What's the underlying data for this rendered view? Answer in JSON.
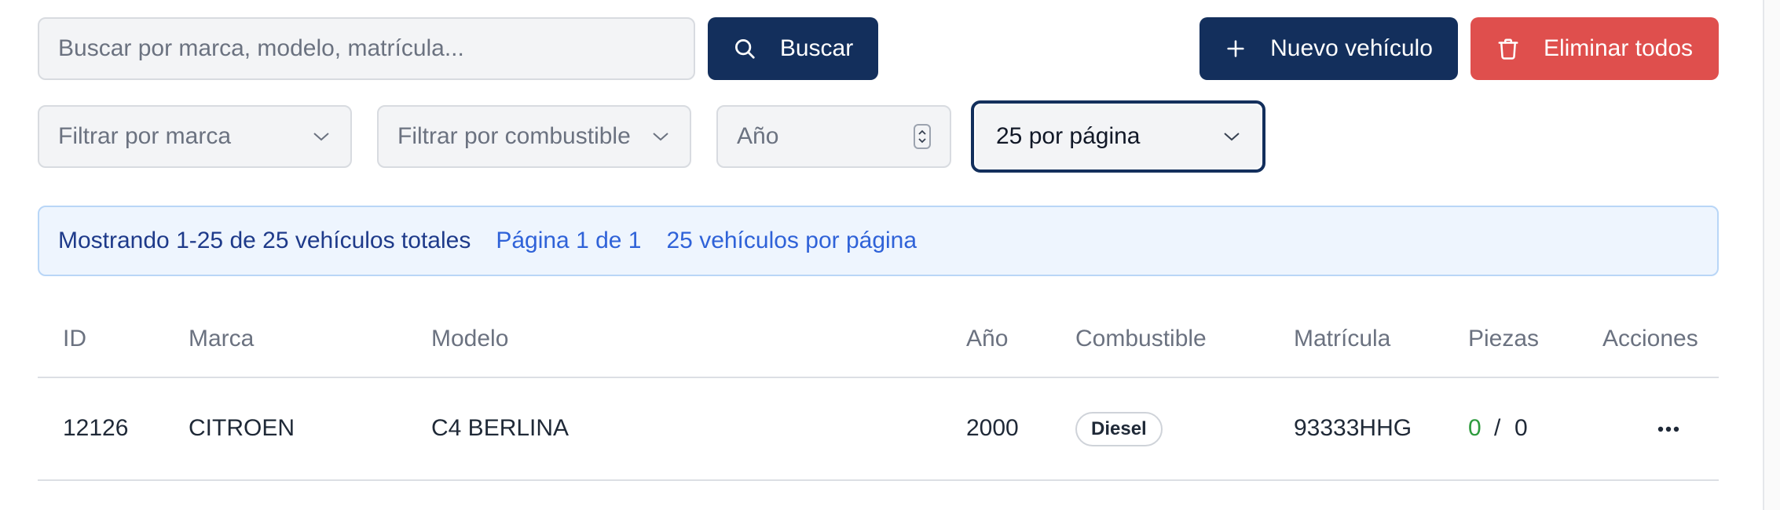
{
  "search": {
    "placeholder": "Buscar por marca, modelo, matrícula...",
    "button_label": "Buscar"
  },
  "actions": {
    "new_vehicle_label": "Nuevo vehículo",
    "delete_all_label": "Eliminar todos"
  },
  "filters": {
    "brand_placeholder": "Filtrar por marca",
    "fuel_placeholder": "Filtrar por combustible",
    "year_placeholder": "Año",
    "per_page_selected": "25 por página"
  },
  "info": {
    "showing": "Mostrando 1-25 de 25 vehículos totales",
    "page": "Página 1 de 1",
    "per_page": "25 vehículos por página"
  },
  "table": {
    "headers": {
      "id": "ID",
      "brand": "Marca",
      "model": "Modelo",
      "year": "Año",
      "fuel": "Combustible",
      "plate": "Matrícula",
      "parts": "Piezas",
      "actions": "Acciones"
    },
    "rows": [
      {
        "id": "12126",
        "brand": "CITROEN",
        "model": "C4 BERLINA",
        "year": "2000",
        "fuel": "Diesel",
        "plate": "93333HHG",
        "parts_available": "0",
        "parts_separator": "/",
        "parts_total": "0",
        "actions_icon": "more-horizontal-icon"
      }
    ]
  },
  "colors": {
    "primary": "#132f5c",
    "danger": "#df4f4d",
    "info_bg": "#eef5fe",
    "info_link": "#2f62d8",
    "parts_available": "#2e9b3e"
  }
}
